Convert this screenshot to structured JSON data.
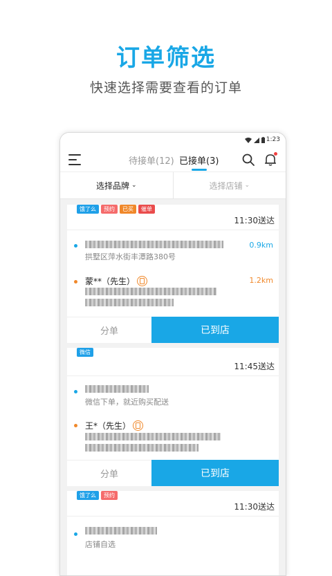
{
  "promo": {
    "title": "订单筛选",
    "subtitle": "快速选择需要查看的订单"
  },
  "statusbar": {
    "time": "1:23"
  },
  "tabs": {
    "pending": "待接单(12)",
    "accepted": "已接单(3)"
  },
  "filters": {
    "brand": "选择品牌",
    "store": "选择店铺"
  },
  "colors": {
    "accent": "#19a7e6",
    "pickup_dot": "#19a7e6",
    "customer_dot": "#f0882a"
  },
  "orders": [
    {
      "tags": [
        {
          "label": "饿了么",
          "color": "#1fa0e8"
        },
        {
          "label": "预约",
          "color": "#f56b6b"
        },
        {
          "label": "已买",
          "color": "#f0882a"
        },
        {
          "label": "催单",
          "color": "#ea4c4c"
        }
      ],
      "delivery_time": "11:30送达",
      "store_address": "拱墅区萍水街丰潭路380号",
      "store_distance": "0.9km",
      "customer": "蒙**（先生）",
      "customer_distance": "1.2km",
      "split_label": "分单",
      "arrived_label": "已到店"
    },
    {
      "tags": [
        {
          "label": "微信",
          "color": "#1fa0e8"
        }
      ],
      "delivery_time": "11:45送达",
      "store_address": "微信下单，就近购买配送",
      "customer": "王*（先生）",
      "split_label": "分单",
      "arrived_label": "已到店"
    },
    {
      "tags": [
        {
          "label": "饿了么",
          "color": "#1fa0e8"
        },
        {
          "label": "预约",
          "color": "#f56b6b"
        }
      ],
      "delivery_time": "11:30送达",
      "store_address": "店铺自选"
    }
  ]
}
